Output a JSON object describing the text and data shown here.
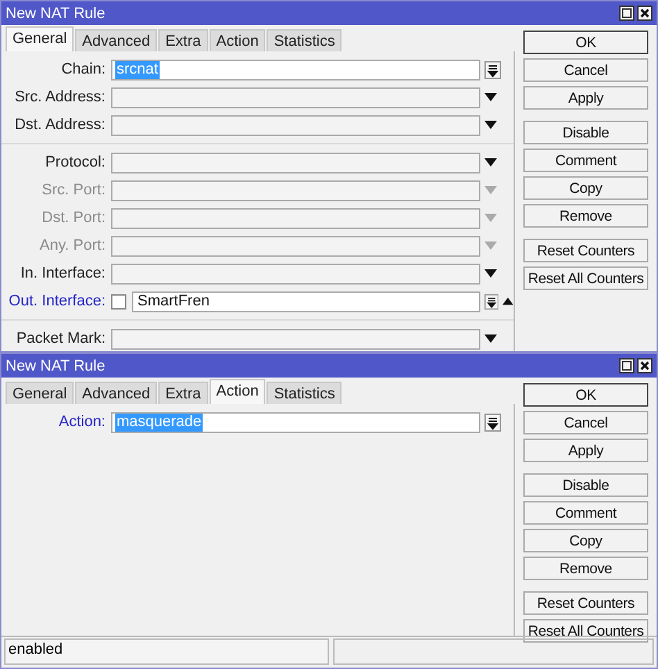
{
  "windows": [
    {
      "title": "New NAT Rule",
      "tabs": [
        {
          "label": "General",
          "selected": true
        },
        {
          "label": "Advanced",
          "selected": false
        },
        {
          "label": "Extra",
          "selected": false
        },
        {
          "label": "Action",
          "selected": false
        },
        {
          "label": "Statistics",
          "selected": false
        }
      ],
      "sections": [
        [
          {
            "label": "Chain:",
            "value": "srcnat",
            "value_selected": true,
            "kind": "combo",
            "disabled": false,
            "label_active": false
          },
          {
            "label": "Src. Address:",
            "kind": "select",
            "disabled": false,
            "label_active": false
          },
          {
            "label": "Dst. Address:",
            "kind": "select",
            "disabled": false,
            "label_active": false
          }
        ],
        [
          {
            "label": "Protocol:",
            "kind": "select",
            "disabled": false,
            "label_active": false
          },
          {
            "label": "Src. Port:",
            "kind": "select",
            "disabled": true,
            "label_active": false
          },
          {
            "label": "Dst. Port:",
            "kind": "select",
            "disabled": true,
            "label_active": false
          },
          {
            "label": "Any. Port:",
            "kind": "select",
            "disabled": true,
            "label_active": false
          },
          {
            "label": "In. Interface:",
            "kind": "select",
            "disabled": false,
            "label_active": false
          },
          {
            "label": "Out. Interface:",
            "value": "SmartFren",
            "value_selected": false,
            "kind": "combo_collapse",
            "disabled": false,
            "label_active": true,
            "negate": {
              "checked": false
            }
          }
        ],
        [
          {
            "label": "Packet Mark:",
            "kind": "select",
            "disabled": false,
            "label_active": false
          }
        ]
      ],
      "button_groups": [
        [
          {
            "label": "OK",
            "default": true
          },
          {
            "label": "Cancel",
            "default": false
          },
          {
            "label": "Apply",
            "default": false
          }
        ],
        [
          {
            "label": "Disable",
            "default": false
          },
          {
            "label": "Comment",
            "default": false
          },
          {
            "label": "Copy",
            "default": false
          },
          {
            "label": "Remove",
            "default": false
          }
        ],
        [
          {
            "label": "Reset Counters",
            "default": false
          },
          {
            "label": "Reset All Counters",
            "default": false
          }
        ]
      ]
    },
    {
      "title": "New NAT Rule",
      "tabs": [
        {
          "label": "General",
          "selected": false
        },
        {
          "label": "Advanced",
          "selected": false
        },
        {
          "label": "Extra",
          "selected": false
        },
        {
          "label": "Action",
          "selected": true
        },
        {
          "label": "Statistics",
          "selected": false
        }
      ],
      "sections": [
        [
          {
            "label": "Action:",
            "value": "masquerade",
            "value_selected": true,
            "kind": "combo",
            "disabled": false,
            "label_active": true
          }
        ]
      ],
      "button_groups": [
        [
          {
            "label": "OK",
            "default": true
          },
          {
            "label": "Cancel",
            "default": false
          },
          {
            "label": "Apply",
            "default": false
          }
        ],
        [
          {
            "label": "Disable",
            "default": false
          },
          {
            "label": "Comment",
            "default": false
          },
          {
            "label": "Copy",
            "default": false
          },
          {
            "label": "Remove",
            "default": false
          }
        ],
        [
          {
            "label": "Reset Counters",
            "default": false
          },
          {
            "label": "Reset All Counters",
            "default": false
          }
        ]
      ],
      "status_bar": [
        "enabled"
      ]
    }
  ]
}
